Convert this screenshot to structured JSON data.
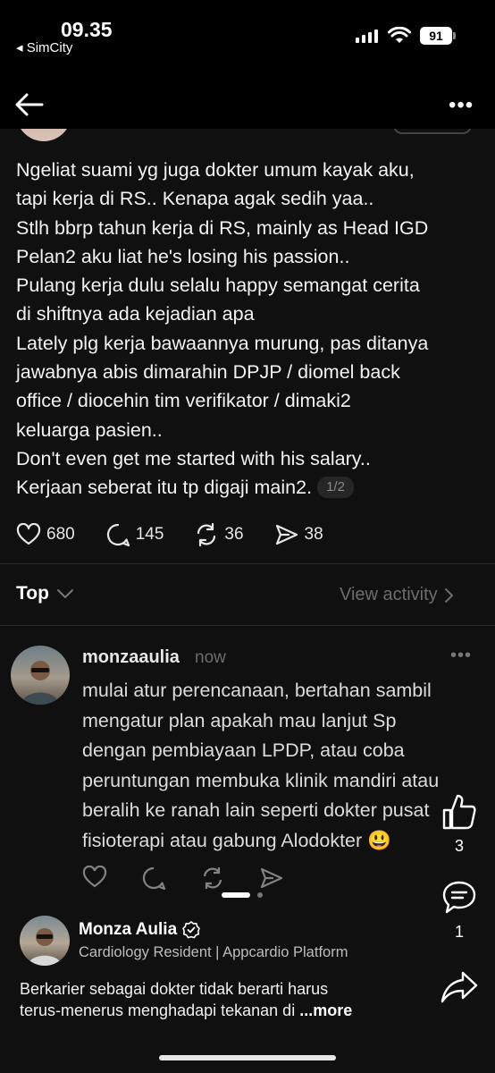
{
  "status": {
    "time": "09.35",
    "back_app": "◂ SimCity",
    "battery": "91"
  },
  "post": {
    "text": "Ngeliat suami yg juga dokter umum kayak aku,\ntapi kerja di RS.. Kenapa agak sedih yaa..\nStlh bbrp tahun kerja di RS, mainly as Head IGD\nPelan2 aku liat he's losing his passion..\nPulang kerja dulu selalu happy semangat cerita\ndi shiftnya ada kejadian apa\nLately plg kerja bawaannya murung, pas ditanya\njawabnya abis dimarahin DPJP / diomel back\noffice / diocehin tim verifikator / dimaki2\nkeluarga pasien..\nDon't even get me started with his salary..\nKerjaan seberat itu tp digaji main2.",
    "page_indicator": "1/2",
    "likes": "680",
    "replies": "145",
    "reposts": "36",
    "shares": "38"
  },
  "sort": {
    "label": "Top",
    "view_activity": "View activity"
  },
  "reply": {
    "username": "monzaaulia",
    "time": "now",
    "text": "mulai atur perencanaan, bertahan sambil\nmengatur plan apakah mau lanjut Sp\ndengan pembiayaan LPDP, atau coba\nperuntungan membuka klinik mandiri atau\nberalih ke ranah lain seperti dokter pusat\nfisioterapi atau gabung Alodokter 😃"
  },
  "ad": {
    "like_count": "3",
    "comment_count": "1",
    "name": "Monza Aulia",
    "title": "Cardiology Resident | Appcardio Platform",
    "text": "Berkarier sebagai dokter tidak berarti harus\nterus-menerus menghadapi tekanan di ",
    "more": "...more"
  },
  "icons": {
    "back": "arrow-left-icon",
    "more": "more-horizontal-icon",
    "like": "heart-icon",
    "reply": "comment-icon",
    "repost": "repost-icon",
    "share": "send-icon",
    "thumb": "thumbs-up-icon",
    "verified": "verified-badge-icon"
  }
}
